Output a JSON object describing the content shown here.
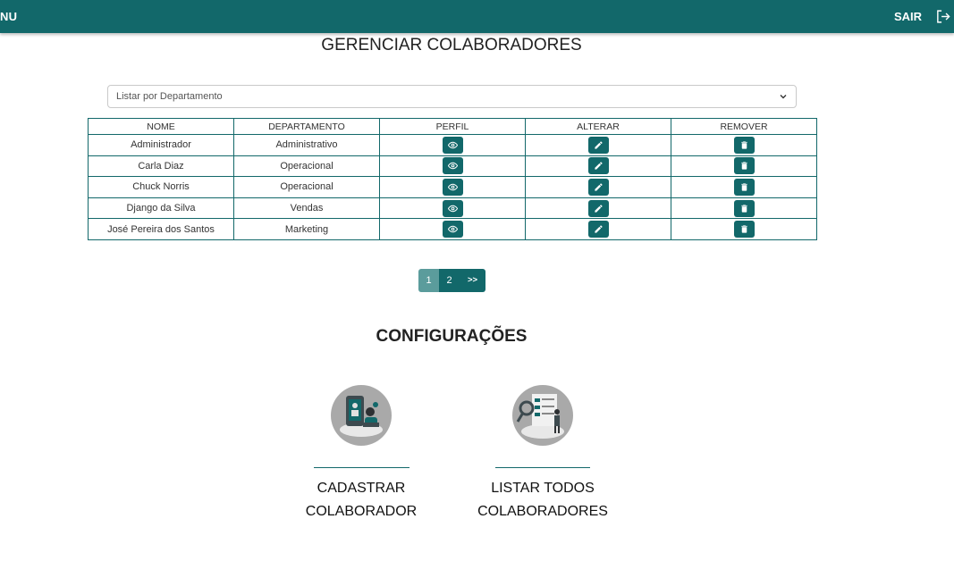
{
  "header": {
    "menu_label": "NU",
    "logout_label": "SAIR",
    "icons": [
      "logout-icon"
    ],
    "color": "#12686a"
  },
  "page": {
    "title": "GERENCIAR COLABORADORES"
  },
  "filter": {
    "placeholder": "Listar por Departamento"
  },
  "table": {
    "columns": [
      "NOME",
      "DEPARTAMENTO",
      "PERFIL",
      "ALTERAR",
      "REMOVER"
    ],
    "rows": [
      {
        "nome": "Administrador",
        "departamento": "Administrativo"
      },
      {
        "nome": "Carla Diaz",
        "departamento": "Operacional"
      },
      {
        "nome": "Chuck Norris",
        "departamento": "Operacional"
      },
      {
        "nome": "Django da Silva",
        "departamento": "Vendas"
      },
      {
        "nome": "José Pereira dos Santos",
        "departamento": "Marketing"
      }
    ],
    "action_icons": [
      "eye-icon",
      "pencil-icon",
      "trash-icon"
    ]
  },
  "pagination": {
    "pages": [
      "1",
      "2"
    ],
    "next": ">>",
    "current": "1"
  },
  "config": {
    "title": "CONFIGURAÇÕES",
    "cards": [
      {
        "line1": "CADASTRAR",
        "line2": "COLABORADOR",
        "icon": "register-collaborator-illustration"
      },
      {
        "line1": "LISTAR TODOS",
        "line2": "COLABORADORES",
        "icon": "list-collaborators-illustration"
      }
    ]
  }
}
